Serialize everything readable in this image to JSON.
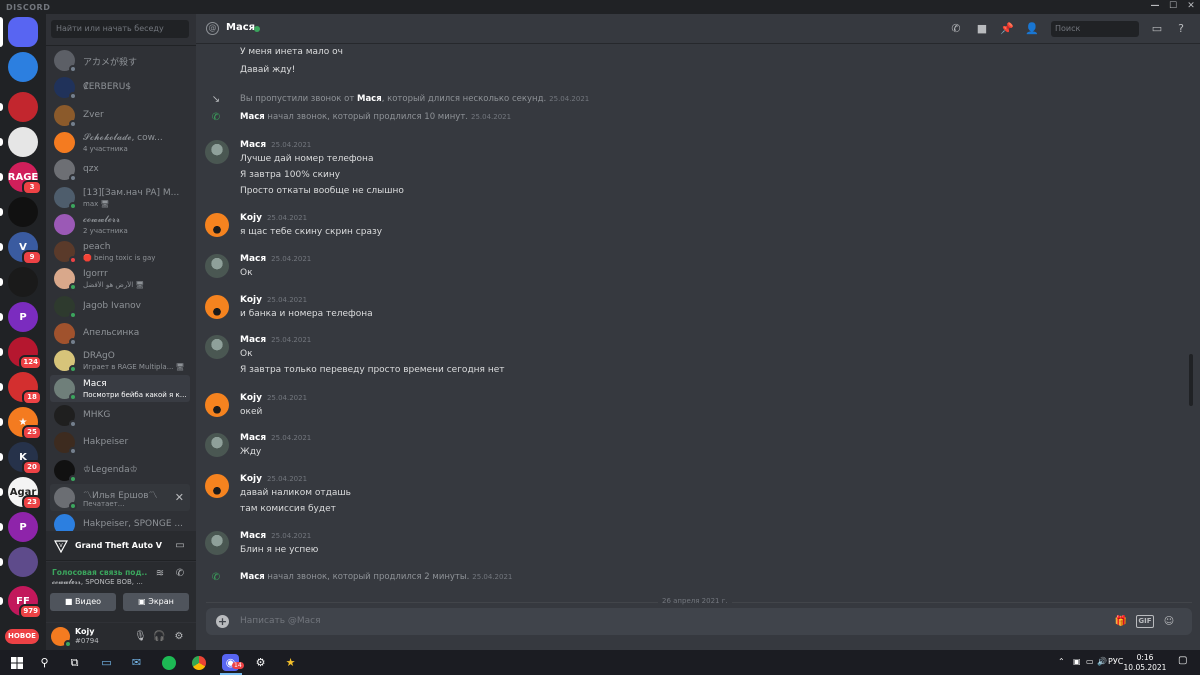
{
  "app": {
    "brand": "DISCORD",
    "window_controls": [
      "—",
      "☐",
      "✕"
    ]
  },
  "rail": {
    "servers": [
      {
        "icon": "discord-home-icon",
        "color": "#5865f2",
        "label": "",
        "badge": ""
      },
      {
        "icon": "friends-group-icon",
        "color": "#2c7fe0",
        "label": "",
        "badge": ""
      },
      {
        "icon": "avatar-red",
        "color": "#c2262e",
        "label": "",
        "badge": ""
      },
      {
        "icon": "avatar-white",
        "color": "#e6e6e6",
        "label": "",
        "badge": ""
      },
      {
        "icon": "rage-server",
        "color": "#d01f5a",
        "label": "RAGE",
        "badge": "3"
      },
      {
        "icon": "avatar-dark",
        "color": "#111111",
        "label": "",
        "badge": ""
      },
      {
        "icon": "v-server",
        "color": "#3a5ba0",
        "label": "V",
        "badge": "9"
      },
      {
        "icon": "skull-server",
        "color": "#1a1a1a",
        "label": "",
        "badge": ""
      },
      {
        "icon": "purple-server",
        "color": "#7b2cbf",
        "label": "P",
        "badge": ""
      },
      {
        "icon": "red-server",
        "color": "#b5172f",
        "label": "",
        "badge": "124"
      },
      {
        "icon": "red-g-server",
        "color": "#d32f2f",
        "label": "",
        "badge": "18"
      },
      {
        "icon": "star-server",
        "color": "#f47b20",
        "label": "★",
        "badge": "25"
      },
      {
        "icon": "blue-server",
        "color": "#26324a",
        "label": "K",
        "badge": "20"
      },
      {
        "icon": "agar-server",
        "color": "#f4f4f4",
        "label": "Agar",
        "badge": "23"
      },
      {
        "icon": "purple-p-server",
        "color": "#8e24aa",
        "label": "P",
        "badge": ""
      },
      {
        "icon": "galaxy-server",
        "color": "#5e4b8b",
        "label": "",
        "badge": ""
      },
      {
        "icon": "ff-server",
        "color": "#c2185b",
        "label": "FF",
        "badge": "979"
      }
    ],
    "new_badge": "НОВОЕ"
  },
  "sidebar": {
    "search_placeholder": "Найти или начать беседу",
    "dms": [
      {
        "name": "アカメが殺す",
        "sub": "",
        "color": "#5c5f66",
        "status": "#747f8d"
      },
      {
        "name": "₡ERBERU$",
        "sub": "",
        "color": "#20325a",
        "status": "#747f8d"
      },
      {
        "name": "Zver",
        "sub": "",
        "color": "#8b5a2b",
        "status": "#747f8d"
      },
      {
        "name": "𝓢𝓬𝓱𝓸𝓴𝓸𝓵𝓪𝓭𝓮, cow...",
        "sub": "4 участника",
        "color": "#f47b20",
        "status": ""
      },
      {
        "name": "qzx",
        "sub": "",
        "color": "#6d6f74",
        "status": "#747f8d"
      },
      {
        "name": "[13][Зам.нач PA] M...",
        "sub": "max 🖥",
        "color": "#4e5d6c",
        "status": "#3ba55d"
      },
      {
        "name": "𝓬𝓸𝔀𝔀𝓵𝓮𝓻𝓻",
        "sub": "2 участника",
        "color": "#9b59b6",
        "status": ""
      },
      {
        "name": "peach",
        "sub": "🛑 being toxic is gay",
        "color": "#5a3a2a",
        "status": "#ed4245"
      },
      {
        "name": "Igorrr",
        "sub": "الأرض هو الأفضل 🖥",
        "color": "#d9a88b",
        "status": "#3ba55d"
      },
      {
        "name": "Jagob Ivanov",
        "sub": "",
        "color": "#2e3a2e",
        "status": "#3ba55d"
      },
      {
        "name": "Апельсинка",
        "sub": "",
        "color": "#a0522d",
        "status": "#747f8d"
      },
      {
        "name": "DRAgO",
        "sub": "Играет в RAGE Multipla... 🖥",
        "color": "#d7c47a",
        "status": "#3ba55d"
      },
      {
        "name": "Мася",
        "sub": "Посмотри бейба какой я кр...",
        "color": "#6f7f7a",
        "status": "#3ba55d"
      },
      {
        "name": "MHKG",
        "sub": "",
        "color": "#1f1f1f",
        "status": "#747f8d"
      },
      {
        "name": "Hakpeiser",
        "sub": "",
        "color": "#3d2b1f",
        "status": "#747f8d"
      },
      {
        "name": "♔Legenda♔",
        "sub": "",
        "color": "#111111",
        "status": "#3ba55d"
      },
      {
        "name": "〽Илья Ершов〽",
        "sub": "Печатает...",
        "color": "#6b6e73",
        "status": "#3ba55d"
      },
      {
        "name": "Hakpeiser, SPONGE ...",
        "sub": "",
        "color": "#2c7fe0",
        "status": ""
      }
    ],
    "game": {
      "name": "Grand Theft Auto V"
    },
    "voice": {
      "title": "Голосовая связь под...",
      "sub": "𝓬𝓸𝔀𝔀𝓵𝓮𝓻𝓻, SPONGE BOB, ...",
      "video_label": "Видео",
      "screen_label": "Экран"
    },
    "user": {
      "name": "Kojy",
      "tag": "#0794"
    }
  },
  "header": {
    "name": "Мася",
    "search_placeholder": "Поиск"
  },
  "chat": {
    "top_lines": [
      "У меня инета мало оч",
      "Давай жду!"
    ],
    "missed_call": {
      "prefix": "Вы пропустили звонок от",
      "who": "Мася",
      "suffix": ", который длился несколько секунд.",
      "ts": "25.04.2021"
    },
    "call_1": {
      "who": "Мася",
      "text": "начал звонок, который продлился 10 минут.",
      "ts": "25.04.2021"
    },
    "groups": [
      {
        "author": "Мася",
        "ts": "25.04.2021",
        "lines": [
          "Лучше дай номер телефона",
          "Я завтра 100% скину",
          "Просто откаты вообще не слышно"
        ]
      },
      {
        "author": "Kojy",
        "ts": "25.04.2021",
        "lines": [
          "я щас тебе скину скрин сразу"
        ]
      },
      {
        "author": "Мася",
        "ts": "25.04.2021",
        "lines": [
          "Ок"
        ]
      },
      {
        "author": "Kojy",
        "ts": "25.04.2021",
        "lines": [
          "и банка и номера телефона"
        ]
      },
      {
        "author": "Мася",
        "ts": "25.04.2021",
        "lines": [
          "Ок",
          "Я завтра только переведу просто времени сегодня нет"
        ]
      },
      {
        "author": "Kojy",
        "ts": "25.04.2021",
        "lines": [
          "окей"
        ]
      },
      {
        "author": "Мася",
        "ts": "25.04.2021",
        "lines": [
          "Жду"
        ]
      },
      {
        "author": "Kojy",
        "ts": "25.04.2021",
        "lines": [
          "давай наликом отдашь",
          "там комиссия будет"
        ]
      },
      {
        "author": "Мася",
        "ts": "25.04.2021",
        "lines": [
          "Блин я не успею"
        ]
      }
    ],
    "call_2": {
      "who": "Мася",
      "text": "начал звонок, который продлился 2 минуты.",
      "ts": "25.04.2021"
    },
    "day_divider": "26 апреля 2021 г."
  },
  "composer": {
    "placeholder": "Написать @Мася",
    "gif_label": "GIF"
  },
  "taskbar": {
    "lang": "РУС",
    "time": "0:16",
    "date": "10.05.2021",
    "discord_badge": "14"
  }
}
